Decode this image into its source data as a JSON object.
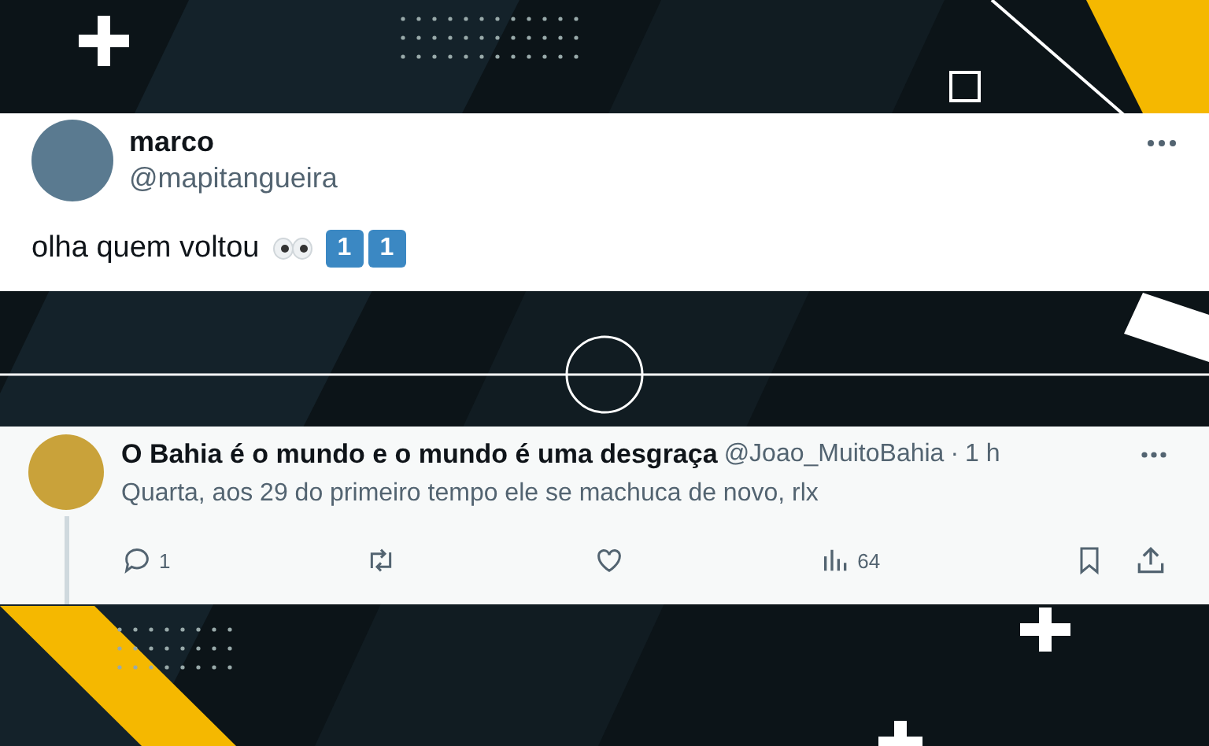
{
  "main_post": {
    "name": "marco",
    "handle": "@mapitangueira",
    "text": "olha quem voltou",
    "keycaps": [
      "1",
      "1"
    ]
  },
  "reply": {
    "name": "O Bahia é o mundo e o mundo é uma desgraça",
    "handle": "@Joao_MuitoBahia",
    "separator": "·",
    "time": "1 h",
    "text": "Quarta, aos 29 do primeiro tempo ele se machuca de novo, rlx",
    "replies": "1",
    "views": "64"
  }
}
